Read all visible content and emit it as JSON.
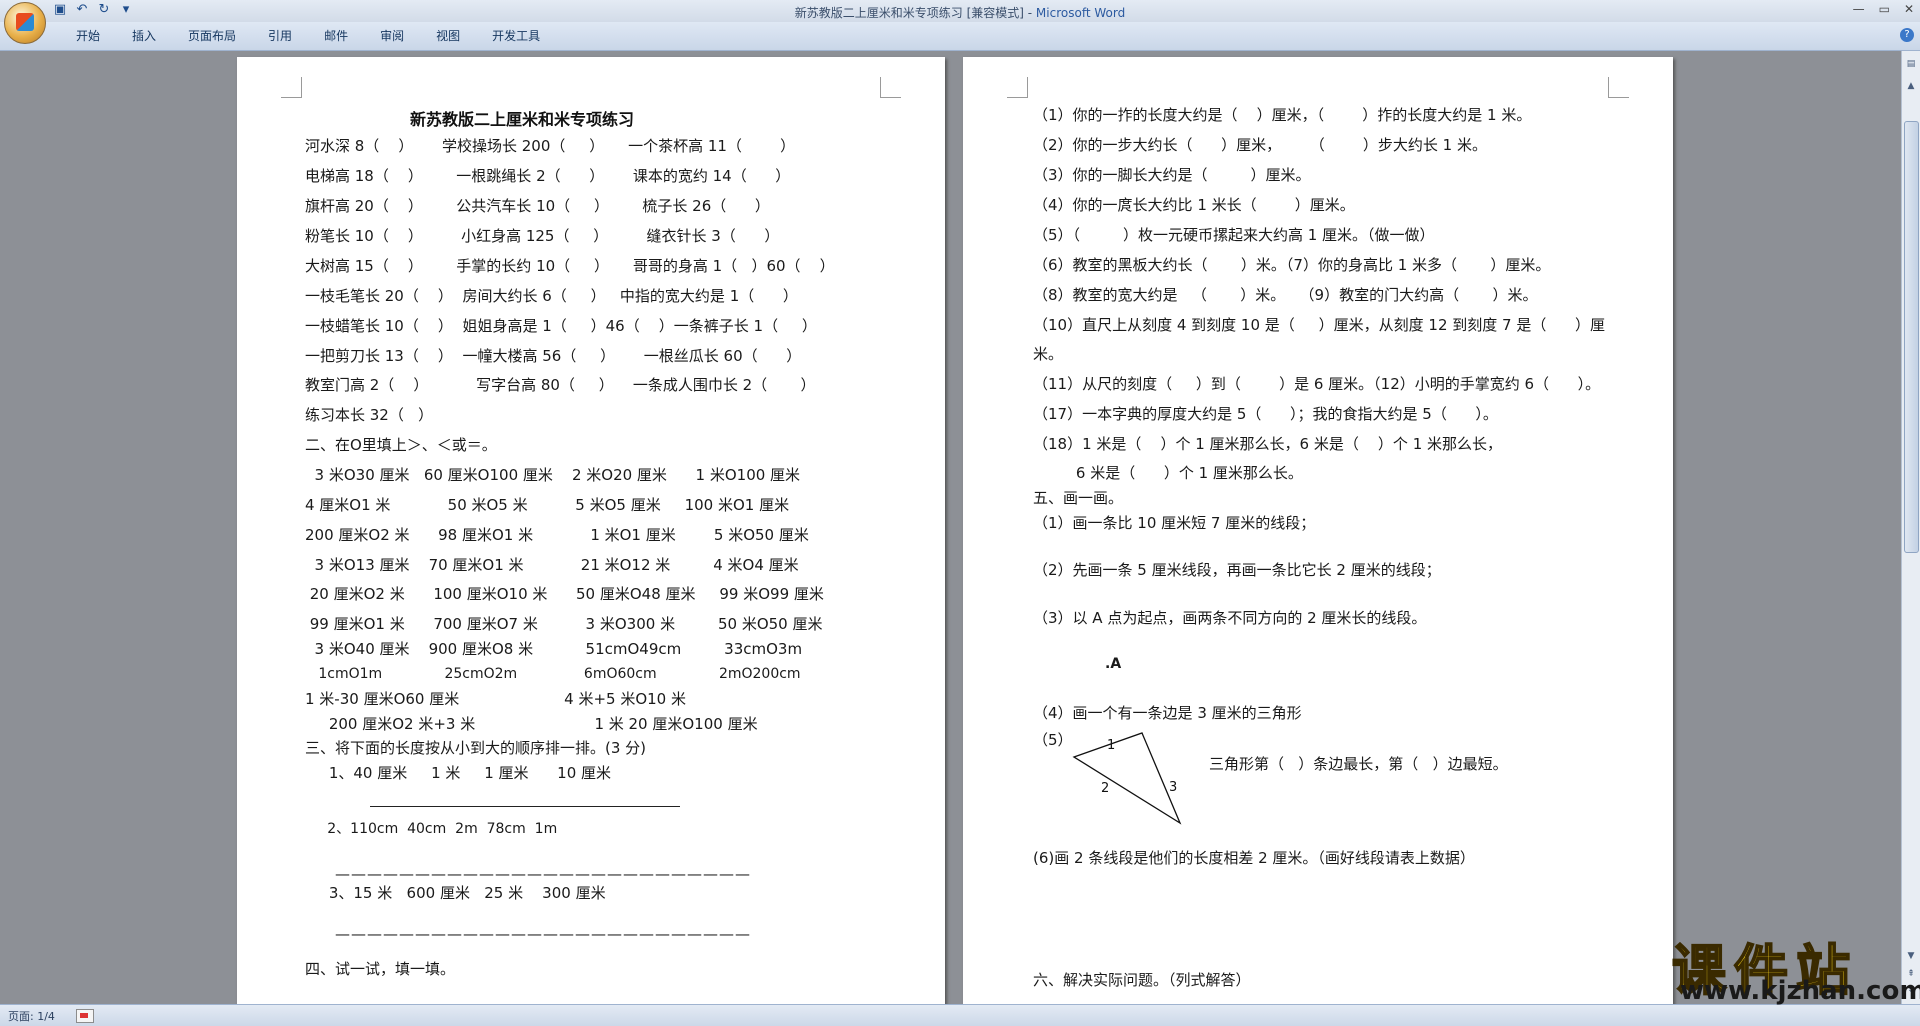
{
  "window": {
    "title": "新苏教版二上厘米和米专项练习 [兼容模式] - ",
    "app": "Microsoft Word"
  },
  "ribbon": {
    "tabs": [
      "开始",
      "插入",
      "页面布局",
      "引用",
      "邮件",
      "审阅",
      "视图",
      "开发工具"
    ]
  },
  "status": {
    "page": "页面: 1/4"
  },
  "page1": {
    "title": "新苏教版二上厘米和米专项练习",
    "lines": [
      "河水深 8（    ）      学校操场长 200（     ）     一个茶杯高 11（        ）",
      "电梯高 18（    ）       一根跳绳长 2（      ）      课本的宽约 14（      ）",
      "旗杆高 20（    ）       公共汽车长 10（     ）       梳子长 26（      ）",
      "粉笔长 10（    ）        小红身高 125（     ）        缝衣针长 3（      ）",
      "大树高 15（    ）       手掌的长约 10（     ）     哥哥的身高 1（   ）60（    ）",
      "一枝毛笔长 20（    ）  房间大约长 6（     ）   中指的宽大约是 1（      ）",
      "一枝蜡笔长 10（    ）  姐姐身高是 1（     ）46（    ）一条裤子长 1（     ）",
      "一把剪刀长 13（    ）  一幢大楼高 56（     ）      一根丝瓜长 60（      ）",
      "教室门高 2（    ）          写字台高 80（     ）    一条成人围巾长 2（       ）",
      "练习本长 32（   ）",
      "二、在O里填上＞、＜或＝。",
      "  3 米O30 厘米   60 厘米O100 厘米    2 米O20 厘米      1 米O100 厘米",
      "4 厘米O1 米            50 米O5 米          5 米O5 厘米     100 米O1 厘米",
      "200 厘米O2 米      98 厘米O1 米            1 米O1 厘米        5 米O50 厘米",
      "  3 米O13 厘米    70 厘米O1 米            21 米O12 米         4 米O4 厘米",
      " 20 厘米O2 米      100 厘米O10 米      50 厘米O48 厘米     99 米O99 厘米",
      " 99 厘米O1 米      700 厘米O7 米          3 米O300 米         50 米O50 厘米",
      "  3 米O40 厘米    900 厘米O8 米           51cmO49cm         33cmO3m",
      "   1cmO1m              25cmO2m               6mO60cm              2mO200cm",
      "1 米-30 厘米O60 厘米                      4 米+5 米O10 米",
      "     200 厘米O2 米+3 米                         1 米 20 厘米O100 厘米",
      "三、将下面的长度按从小到大的顺序排一排。(3 分)",
      "     1、40 厘米     1 米     1 厘米      10 厘米",
      "     2、110cm  40cm  2m  78cm  1m",
      "     3、15 米   600 厘米   25 米    300 厘米",
      "四、试一试，填一填。"
    ]
  },
  "page2": {
    "lines": [
      "（1）你的一拃的长度大约是（    ）厘米，（        ）拃的长度大约是 1 米。",
      "（2）你的一步大约长（      ）厘米，      （        ）步大约长 1 米。",
      "（3）你的一脚长大约是（         ）厘米。",
      "（4）你的一庹长大约比 1 米长（        ）厘米。",
      "（5）（         ）枚一元硬币摞起来大约高 1 厘米。（做一做）",
      "（6）教室的黑板大约长（       ）米。（7）你的身高比 1 米多（       ）厘米。",
      "（8）教室的宽大约是   （       ）米。   （9）教室的门大约高（       ）米。",
      "（10）直尺上从刻度 4 到刻度 10 是（     ）厘米，从刻度 12 到刻度 7 是（      ）厘",
      "米。",
      "（11）从尺的刻度（     ）到（        ）是 6 厘米。（12）小明的手掌宽约 6（      ）。",
      "（17）一本字典的厚度大约是 5（      ）；我的食指大约是 5（      ）。",
      "（18）1 米是（    ）个 1 厘米那么长，6 米是（    ）个 1 米那么长，",
      "         6 米是（      ）个 1 厘米那么长。",
      "五、画一画。",
      "（1）画一条比 10 厘米短 7 厘米的线段；",
      "（2）先画一条 5 厘米线段，再画一条比它长 2 厘米的线段；",
      "（3）以 A 点为起点，画两条不同方向的 2 厘米长的线段。",
      ".A",
      "（4）画一个有一条边是 3 厘米的三角形",
      "（5）",
      "三角形第（   ）条边最长，第（   ）边最短。",
      "(6)画 2 条线段是他们的长度相差 2 厘米。（画好线段请表上数据）",
      "六、解决实际问题。（列式解答）"
    ],
    "triangle_labels": [
      "1",
      "2",
      "3"
    ]
  },
  "watermark": {
    "cn": "课件站",
    "url": "www.kjzhan.com"
  }
}
